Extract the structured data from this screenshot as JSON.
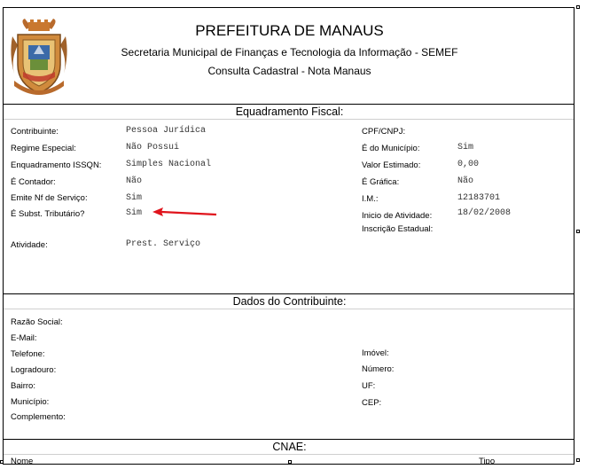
{
  "header": {
    "title": "PREFEITURA DE MANAUS",
    "subtitle": "Secretaria Municipal de Finanças e Tecnologia da Informação - SEMEF",
    "subtitle2": "Consulta Cadastral - Nota Manaus"
  },
  "enquadramento": {
    "title": "Equadramento Fiscal:",
    "left": [
      {
        "label": "Contribuinte:",
        "value": "Pessoa Jurídica"
      },
      {
        "label": "Regime Especial:",
        "value": "Não Possui"
      },
      {
        "label": "Enquadramento ISSQN:",
        "value": "Simples Nacional"
      },
      {
        "label": "É Contador:",
        "value": "Não"
      },
      {
        "label": "Emite Nf de Serviço:",
        "value": "Sim"
      },
      {
        "label": "É Subst. Tributário?",
        "value": "Sim"
      },
      {
        "label": "Atividade:",
        "value": "Prest. Serviço"
      }
    ],
    "right": [
      {
        "label": "CPF/CNPJ:",
        "value": ""
      },
      {
        "label": "É do Município:",
        "value": "Sim"
      },
      {
        "label": "Valor Estimado:",
        "value": "0,00"
      },
      {
        "label": "É Gráfica:",
        "value": "Não"
      },
      {
        "label": "I.M.:",
        "value": "12183701"
      },
      {
        "label": "Inicio de Atividade:",
        "value": "18/02/2008"
      },
      {
        "label": "Inscrição Estadual:",
        "value": ""
      }
    ]
  },
  "contribuinte": {
    "title": "Dados do Contribuinte:",
    "left": [
      "Razão Social:",
      "E-Mail:",
      "Telefone:",
      "Logradouro:",
      "Bairro:",
      "Município:",
      "Complemento:"
    ],
    "right": [
      "Imóvel:",
      "Número:",
      "UF:",
      "CEP:"
    ]
  },
  "cnae": {
    "title": "CNAE:",
    "columns": [
      "Nome",
      "Tipo"
    ]
  },
  "colors": {
    "arrow": "#e0141c",
    "border": "#000000"
  }
}
